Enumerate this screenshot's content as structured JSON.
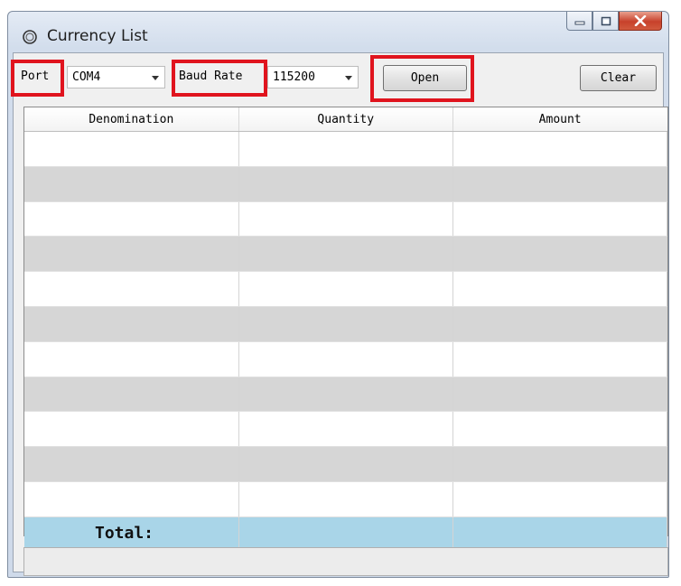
{
  "window": {
    "title": "Currency List"
  },
  "toolbar": {
    "port_label": "Port",
    "port_value": "COM4",
    "baud_label": "Baud Rate",
    "baud_value": "115200",
    "open_label": "Open",
    "clear_label": "Clear"
  },
  "table": {
    "columns": [
      "Denomination",
      "Quantity",
      "Amount"
    ],
    "total_label": "Total:"
  },
  "colors": {
    "total_row": "#a9d5e8",
    "highlight": "#e0141e"
  },
  "icons": [
    "app-circle-icon",
    "minimize-icon",
    "maximize-icon",
    "close-icon",
    "chevron-down-icon"
  ]
}
